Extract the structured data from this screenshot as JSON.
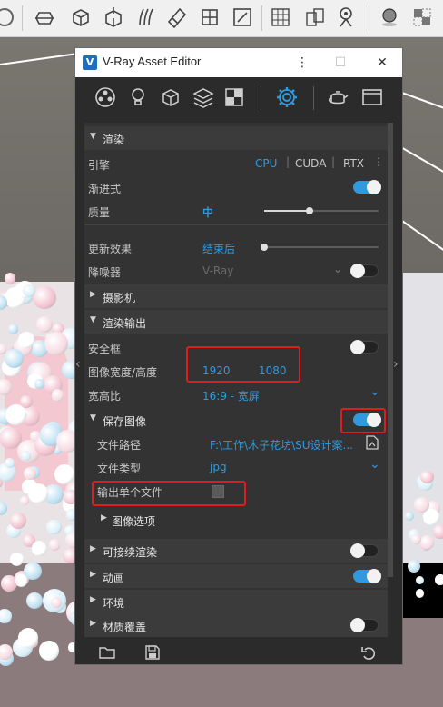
{
  "window": {
    "title": "V-Ray Asset Editor",
    "logo": "V"
  },
  "colors": {
    "accent": "#2f9ae0",
    "annotation": "#e01c1c"
  },
  "render": {
    "section_label": "渲染",
    "engine_label": "引擎",
    "engine_options": [
      "CPU",
      "CUDA",
      "RTX"
    ],
    "engine_selected": "CPU",
    "progressive_label": "渐进式",
    "progressive_on": true,
    "quality_label": "质量",
    "quality_value": "中",
    "quality_level": 0.4,
    "update_effect_label": "更新效果",
    "update_effect_value": "结束后",
    "update_effect_level": 0.0,
    "denoiser_label": "降噪器",
    "denoiser_value": "V-Ray",
    "denoiser_on": false
  },
  "camera": {
    "section_label": "摄影机"
  },
  "render_output": {
    "section_label": "渲染输出",
    "safe_frame_label": "安全框",
    "safe_frame_on": false,
    "image_size_label": "图像宽度/高度",
    "width": "1920",
    "height": "1080",
    "aspect_label": "宽高比",
    "aspect_value": "16:9 - 宽屏"
  },
  "save_image": {
    "section_label": "保存图像",
    "enabled": true,
    "file_path_label": "文件路径",
    "file_path_value": "F:\\工作\\木子花坊\\SU设计案...",
    "file_type_label": "文件类型",
    "file_type_value": "jpg",
    "single_file_label": "输出单个文件",
    "single_file_checked": false,
    "image_options_label": "图像选项"
  },
  "resumable": {
    "section_label": "可接续渲染",
    "on": false
  },
  "animation": {
    "section_label": "动画",
    "on": true
  },
  "environment": {
    "section_label": "环境"
  },
  "material_override": {
    "section_label": "材质覆盖",
    "on": false
  }
}
